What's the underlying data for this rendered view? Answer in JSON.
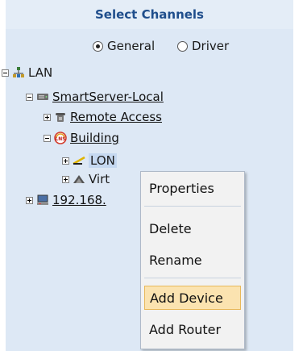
{
  "header": {
    "title": "Select Channels"
  },
  "mode": {
    "options": [
      {
        "label": "General",
        "checked": true
      },
      {
        "label": "Driver",
        "checked": false
      }
    ]
  },
  "tree": {
    "lan": {
      "label": "LAN",
      "icon": "network-icon",
      "expanded": true
    },
    "smartserver": {
      "label": "SmartServer-Local",
      "icon": "server-icon",
      "expanded": true
    },
    "remote_access": {
      "label": "Remote Access",
      "icon": "telephone-icon",
      "expanded": false
    },
    "building": {
      "label": "Building",
      "icon": "building-icon",
      "expanded": true
    },
    "lon": {
      "label": "LON",
      "icon": "lon-channel-icon",
      "expanded": false
    },
    "virtual": {
      "label": "Virt",
      "icon": "virtual-channel-icon",
      "expanded": false
    },
    "ip_node": {
      "label": "192.168.",
      "icon": "computer-icon",
      "expanded": false
    }
  },
  "context_menu": {
    "items": [
      "Properties",
      "Delete",
      "Rename",
      "Add Device",
      "Add Router"
    ],
    "highlighted": "Add Device"
  },
  "colors": {
    "panel_bg": "#dde8f5",
    "header_text": "#1f4e8c",
    "menu_hover": "#fbe3b0"
  }
}
